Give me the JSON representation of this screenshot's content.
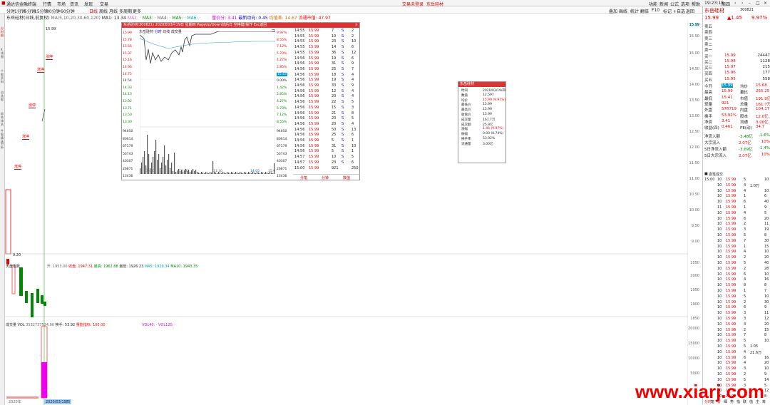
{
  "titlebar": {
    "app": "通达信金融终端",
    "menus": [
      "行情",
      "市场",
      "资讯",
      "发现",
      "交易"
    ],
    "center": "交易未登录",
    "stock": "东岳硅材",
    "right_links": [
      "功能",
      "新闻",
      "公式",
      "选项",
      "帮助"
    ],
    "time": "19:23:18",
    "weekday": "周四"
  },
  "toolbar": {
    "periods": [
      "分时",
      "1分钟",
      "5分钟",
      "15分钟",
      "30分钟",
      "60分钟",
      "日线",
      "周线",
      "月线",
      "多周期",
      "更多"
    ],
    "right": [
      "叠加",
      "画线",
      "统计",
      "翻倍",
      "F10",
      "标记",
      "+自选",
      "返回"
    ]
  },
  "leftbar": [
    "分时图",
    "K线图",
    "个股资料",
    "自选股",
    "综合排名",
    "牛股精选",
    "分析",
    "F10",
    "主力监控",
    "超级盘口"
  ],
  "kline_header": {
    "name": "东岳硅材(日线,前复权)",
    "ma": "MA(5,10,20,30,60,120)",
    "ma1": "MA1: 13.34",
    "ma2": "MA2: ·",
    "ma3": "MA3: ·",
    "ma4": "MA4: ·",
    "ma5": "MA5: ·",
    "ma6": "MA6: ·",
    "extra": [
      "量价分: 3.41",
      "最新动向: 0.45",
      "均值差: 14.67",
      "流通市值: 47.97"
    ]
  },
  "kline_labels": {
    "high": "15.99",
    "low": "9.20",
    "tags": [
      "涨停",
      "涨停",
      "涨停",
      "涨停",
      "涨停"
    ],
    "date": "2020/03/19四",
    "year": "2020年"
  },
  "price_axis": [
    "15.99",
    "15.50",
    "15.00",
    "14.50",
    "14.00",
    "13.50",
    "13.00",
    "12.50",
    "12.00",
    "11.50",
    "11.00",
    "10.50",
    "10.00",
    "9.50",
    "9.00"
  ],
  "mid_panel": {
    "title": "大盘指数",
    "vals": [
      "开: 1953.00",
      "收盘: 1947.31",
      "最高: 1962.88",
      "最低: 1926.23",
      "MA5: 1929.34",
      "MA10: 1943.35"
    ],
    "axis": [
      "2050",
      "2000",
      "1950",
      "1900",
      "1850"
    ]
  },
  "vol_panel": {
    "title": "成交量 VOL",
    "vals": [
      "3532737524.00",
      "换手: 53.92",
      "量能指标: 100.00",
      "VOL40: ·",
      "VOL120: ·"
    ],
    "axis": [
      "20000",
      "15000",
      "10000",
      "5000"
    ]
  },
  "popup": {
    "title": "东岳硅材(300821) 2020年03月19日 星期四 PageUp/Down前后日 空格键/操作 Esc返回",
    "inner_title": "东岳硅材",
    "inner_tabs": [
      "分时",
      "均线",
      "成交量"
    ],
    "left_axis": [
      "15.99",
      "15.78",
      "15.56",
      "15.37",
      "15.16",
      "14.96",
      "14.75",
      "14.54",
      "14.33",
      "14.13",
      "13.92",
      "13.71",
      "13.50",
      "13.30"
    ],
    "right_axis": [
      "9.97%",
      "8.55%",
      "7.12%",
      "5.70%",
      "4.27%",
      "2.85%",
      "1.42%",
      "0.00%",
      "1.42%",
      "2.85%",
      "4.27%",
      "5.70%",
      "7.12%",
      "8.55%"
    ],
    "vol_axis": [
      "94050",
      "80614",
      "67179",
      "53743",
      "40307",
      "26871",
      "13436"
    ],
    "times": [
      "09:30",
      "10:30",
      "11:30",
      "13:00",
      "14:05",
      "15:00"
    ],
    "cur_price": "15.43",
    "ticks": [
      [
        "14:55",
        "15.99",
        "7",
        "S",
        "2"
      ],
      [
        "14:55",
        "15.99",
        "10",
        "S",
        "2"
      ],
      [
        "14:55",
        "15.99",
        "23",
        "S",
        "10"
      ],
      [
        "14:55",
        "15.99",
        "14",
        "S",
        "6"
      ],
      [
        "14:55",
        "15.99",
        "36",
        "S",
        "12"
      ],
      [
        "14:56",
        "15.99",
        "19",
        "S",
        "6"
      ],
      [
        "14:56",
        "15.99",
        "31",
        "S",
        "9"
      ],
      [
        "14:56",
        "15.99",
        "25",
        "S",
        "7"
      ],
      [
        "14:56",
        "15.99",
        "18",
        "S",
        "4"
      ],
      [
        "14:56",
        "15.99",
        "19",
        "S",
        "4"
      ],
      [
        "14:56",
        "15.99",
        "33",
        "S",
        "9"
      ],
      [
        "14:56",
        "15.99",
        "12",
        "S",
        "4"
      ],
      [
        "14:56",
        "15.99",
        "20",
        "S",
        "4"
      ],
      [
        "14:56",
        "15.99",
        "22",
        "S",
        "5"
      ],
      [
        "14:56",
        "15.99",
        "15",
        "S",
        "3"
      ],
      [
        "14:56",
        "15.99",
        "21",
        "S",
        "8"
      ],
      [
        "14:56",
        "15.99",
        "20",
        "S",
        "5"
      ],
      [
        "14:56",
        "15.99",
        "20",
        "S",
        "4"
      ],
      [
        "14:56",
        "15.99",
        "50",
        "S",
        "13"
      ],
      [
        "14:56",
        "15.99",
        "25",
        "S",
        "6"
      ],
      [
        "14:56",
        "15.99",
        "5",
        "S",
        "1"
      ],
      [
        "14:56",
        "15.99",
        "31",
        "S",
        "10"
      ],
      [
        "14:56",
        "15.99",
        "5",
        "S",
        "1"
      ],
      [
        "14:57",
        "15.99",
        "10",
        "S",
        "5"
      ],
      [
        "14:57",
        "15.99",
        "23",
        "S",
        "6"
      ],
      [
        "15:00",
        "15.99",
        "921",
        "",
        "250"
      ]
    ],
    "bottom_tabs": [
      "分笔",
      "分钟",
      "数值"
    ]
  },
  "quote_box": {
    "title": "东岳硅材",
    "rows": [
      [
        "时间",
        "2020/03/19/四"
      ],
      [
        "数值",
        "12.597"
      ],
      [
        "均价",
        "15.99 (9.97%)"
      ],
      [
        "最低价",
        "15.99"
      ],
      [
        "最高价",
        "15.99"
      ],
      [
        "收盘价",
        "15.99"
      ],
      [
        "成交量",
        "161.7万"
      ],
      [
        "成交额",
        "25.9亿"
      ],
      [
        "涨幅",
        "1.45 (9.97%)"
      ],
      [
        "振幅",
        "0.00 (0.74%)"
      ],
      [
        "换手率",
        "53.92%"
      ],
      [
        "流通量",
        "3.00亿"
      ]
    ]
  },
  "right": {
    "name": "东岳硅材",
    "code": "300821",
    "price": "15.99",
    "change": "▲1.45",
    "pct": "9.97%",
    "asks": [
      [
        "卖五",
        "",
        ""
      ],
      [
        "卖四",
        "",
        ""
      ],
      [
        "卖三",
        "",
        ""
      ],
      [
        "卖二",
        "",
        ""
      ],
      [
        "卖一",
        "",
        ""
      ]
    ],
    "bids": [
      [
        "买一",
        "15.99",
        "24447"
      ],
      [
        "买二",
        "15.98",
        "1128"
      ],
      [
        "买三",
        "15.97",
        "215"
      ],
      [
        "买四",
        "15.96",
        "177"
      ],
      [
        "买五",
        "15.95",
        "558"
      ]
    ],
    "stats": [
      [
        "今开",
        "15.99",
        "均价",
        "15.68"
      ],
      [
        "最高",
        "15.99",
        "量比",
        "255.25"
      ],
      [
        "最低",
        "15.41",
        "市值",
        "191.9亿"
      ],
      [
        "现量",
        "921",
        "总量",
        "161.7万"
      ],
      [
        "外盘",
        "576719",
        "内盘",
        "104.17"
      ],
      [
        "换手",
        "53.92%",
        "股本",
        "12.0亿"
      ],
      [
        "净资",
        "3.41",
        "流通",
        "3.00亿"
      ],
      [
        "收益(四)",
        "0.461",
        "PE(动)",
        "34.7"
      ]
    ],
    "flows": [
      [
        "净流入额",
        "-3.48亿",
        "-1.6%"
      ],
      [
        "大宗流入",
        "2.07亿",
        "10%"
      ],
      [
        "5日净流入额",
        "-3.69亿",
        "-1.4%"
      ],
      [
        "5日大宗流入",
        "2.07亿",
        "10%"
      ]
    ],
    "tick_head": "逐笔成交",
    "ticklist": [
      [
        "15:00",
        "10",
        "15.99",
        "5",
        "",
        "10"
      ],
      [
        "",
        "10",
        "15.99",
        "4",
        "1.0万",
        ""
      ],
      [
        "",
        "10",
        "15.99",
        "4",
        "",
        "10"
      ],
      [
        "",
        "10",
        "15.99",
        "1",
        "",
        "6"
      ],
      [
        "",
        "10",
        "15.99",
        "6",
        "",
        "40"
      ],
      [
        "",
        "11",
        "15.99",
        "1",
        "",
        "9"
      ],
      [
        "",
        "10",
        "15.99",
        "4",
        "",
        "5"
      ],
      [
        "",
        "10",
        "15.99",
        "6",
        "",
        "20"
      ],
      [
        "",
        "10",
        "15.99",
        "2",
        "",
        "11"
      ],
      [
        "",
        "10",
        "15.99",
        "3",
        "",
        "19"
      ],
      [
        "",
        "10",
        "15.99",
        "5",
        "",
        "8"
      ],
      [
        "",
        "10",
        "15.99",
        "7",
        "",
        "30"
      ],
      [
        "",
        "10",
        "15.99",
        "1",
        "",
        "15"
      ],
      [
        "",
        "10",
        "15.99",
        "4",
        "",
        "10"
      ],
      [
        "",
        "10",
        "15.99",
        "2",
        "",
        "20"
      ],
      [
        "",
        "10",
        "15.99",
        "5",
        "",
        "40"
      ],
      [
        "",
        "10",
        "15.99",
        "2",
        "",
        "28"
      ],
      [
        "",
        "10",
        "15.99",
        "6",
        "",
        "10"
      ],
      [
        "",
        "10",
        "15.99",
        "4",
        "",
        "16"
      ],
      [
        "",
        "10",
        "15.99",
        "8",
        "",
        "8"
      ],
      [
        "",
        "10",
        "15.99",
        "1",
        "",
        "7"
      ],
      [
        "",
        "10",
        "15.99",
        "5",
        "",
        "10"
      ],
      [
        "",
        "10",
        "15.99",
        "2",
        "",
        "30"
      ],
      [
        "",
        "10",
        "15.99",
        "6",
        "",
        "9"
      ],
      [
        "",
        "10",
        "15.99",
        "3",
        "",
        "11"
      ],
      [
        "",
        "10",
        "15.99",
        "3",
        "",
        "12"
      ],
      [
        "",
        "10",
        "15.99",
        "4",
        "",
        "20"
      ],
      [
        "",
        "10",
        "15.99",
        "2",
        "",
        "15"
      ],
      [
        "",
        "10",
        "15.99",
        "7",
        "",
        "8"
      ],
      [
        "",
        "10",
        "15.99",
        "5",
        "",
        "10"
      ],
      [
        "",
        "10",
        "15.99",
        "5",
        "1.05",
        ""
      ],
      [
        "",
        "10",
        "15.99",
        "4",
        "21.6万",
        ""
      ],
      [
        "",
        "10",
        "15.99",
        "6",
        "",
        "16"
      ],
      [
        "",
        "10",
        "15.99",
        "4",
        "",
        "20"
      ],
      [
        "",
        "10",
        "15.99",
        "3",
        "",
        "10"
      ],
      [
        "",
        "10",
        "15.99",
        "2",
        "",
        "9"
      ],
      [
        "",
        "10",
        "15.99",
        "5",
        "",
        "14"
      ],
      [
        "",
        "10",
        "15.99",
        "3",
        "",
        "5"
      ],
      [
        "",
        "10",
        "15.99",
        "7",
        "",
        "12"
      ],
      [
        "",
        "10",
        "15.99",
        "4",
        "",
        "8"
      ]
    ],
    "tabs": [
      "分时",
      "笔",
      "价",
      "细",
      "势",
      "指",
      "联",
      "值",
      "主",
      "筹"
    ]
  },
  "watermark": "www.xiarj.com"
}
